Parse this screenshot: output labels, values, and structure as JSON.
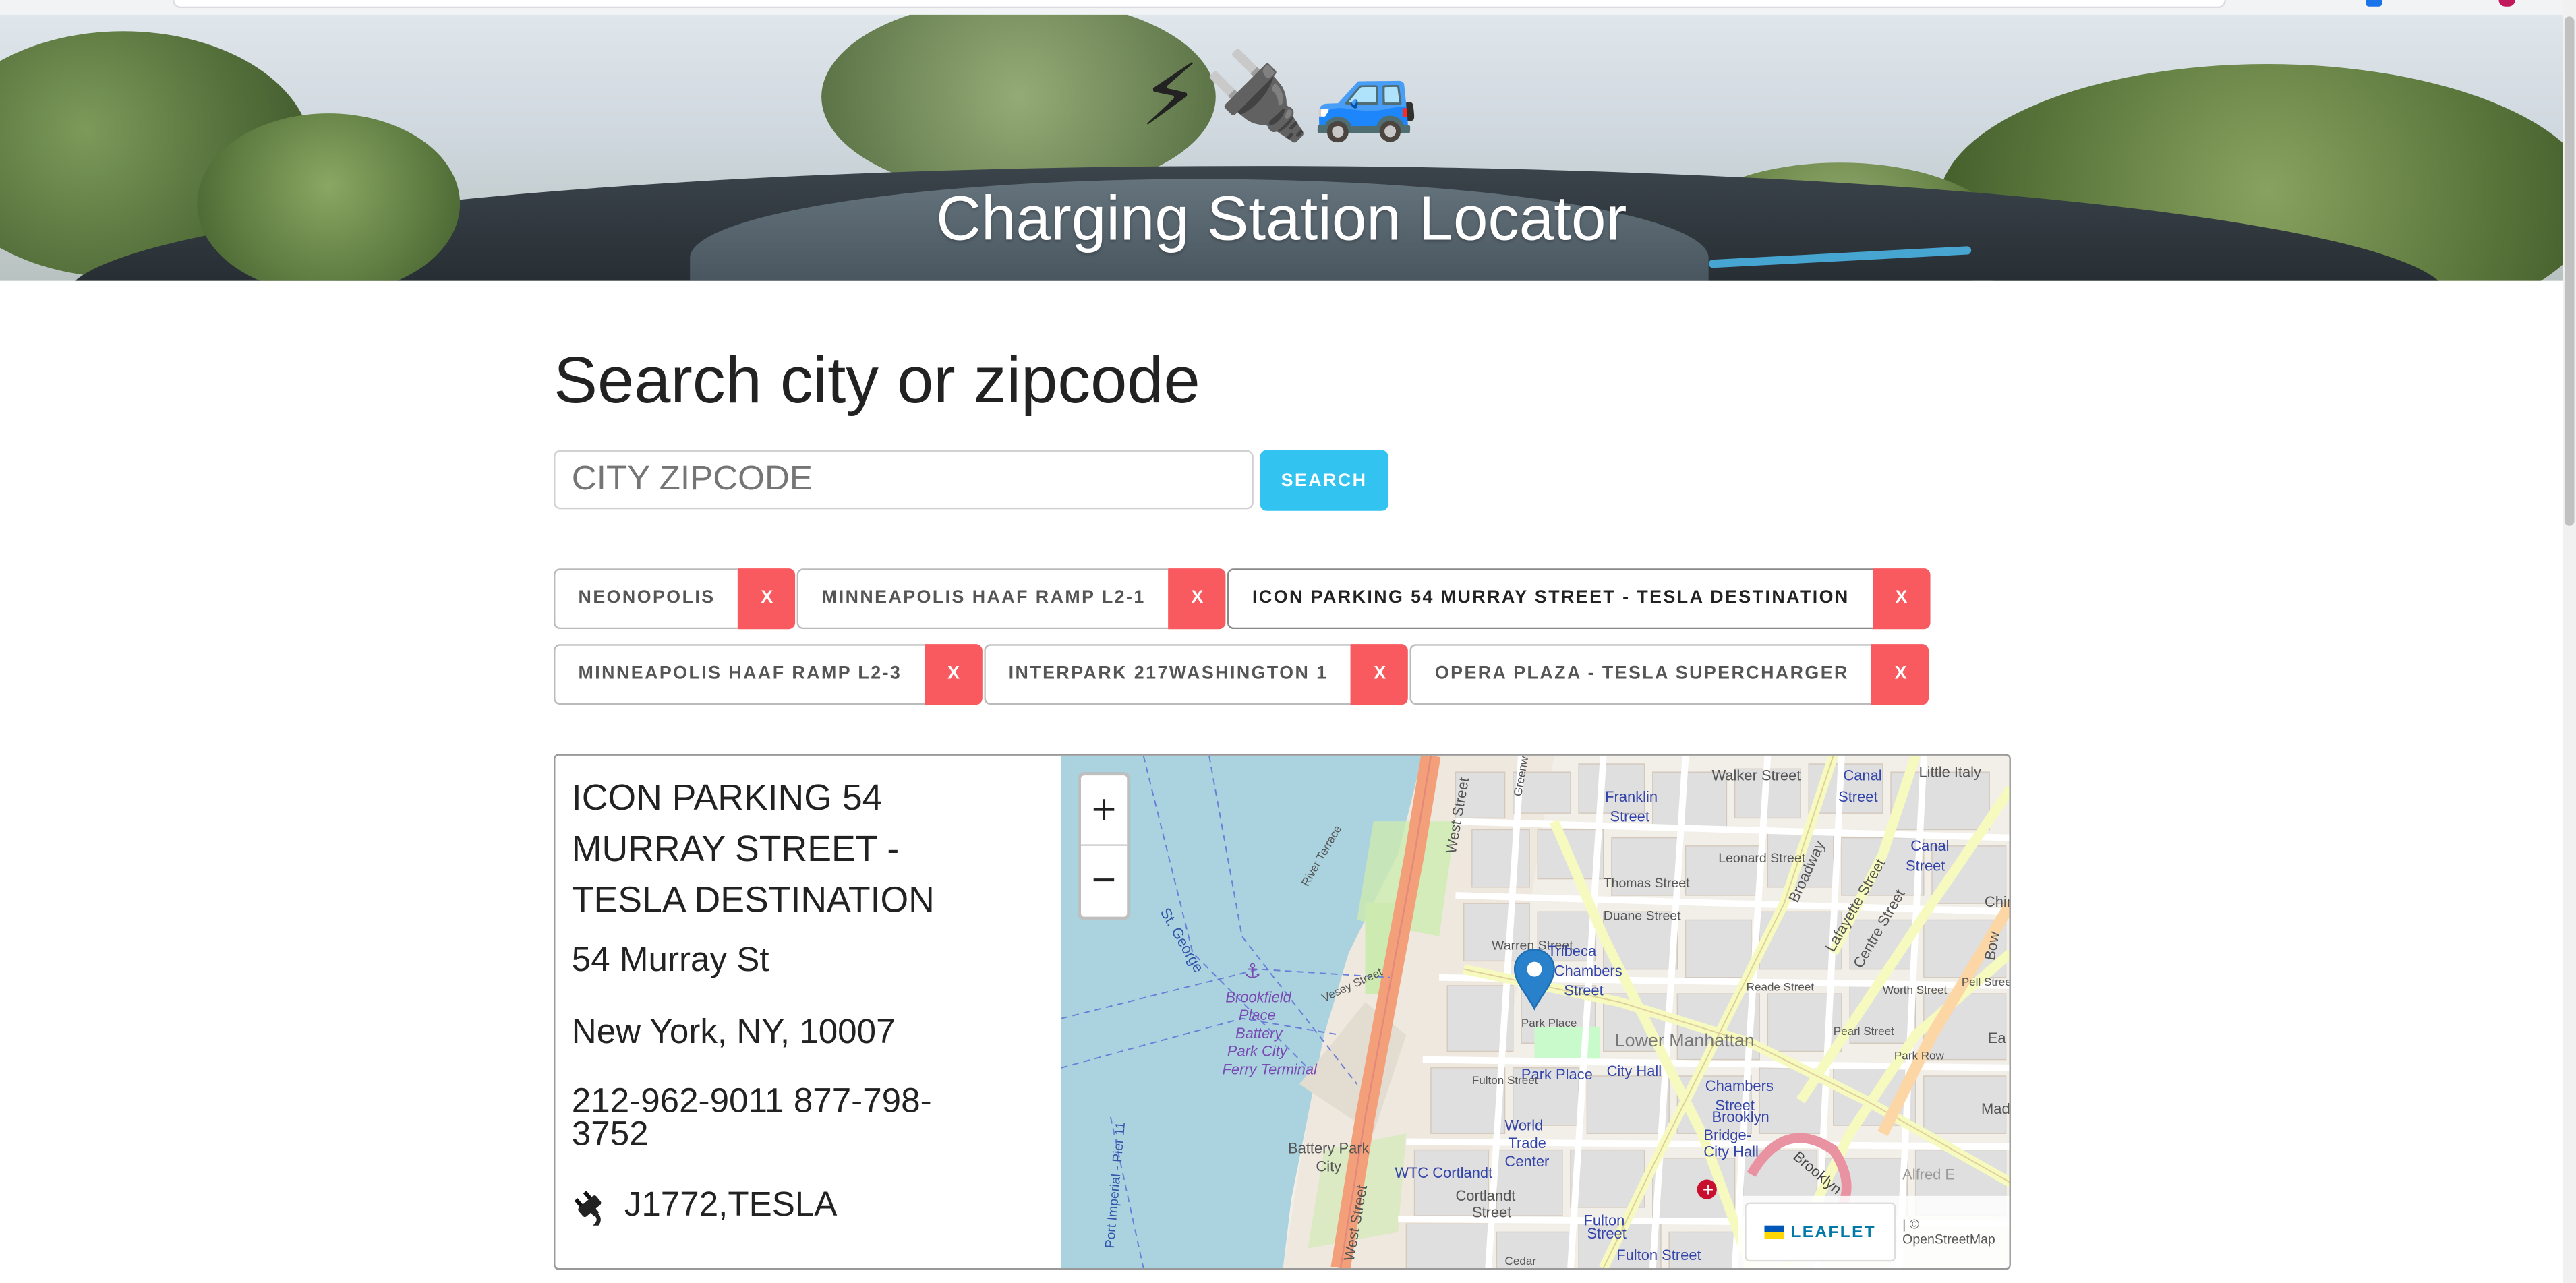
{
  "hero": {
    "emojis": "⚡🔌🚙",
    "title": "Charging Station Locator"
  },
  "search": {
    "heading": "Search city or zipcode",
    "placeholder": "CITY ZIPCODE",
    "value": "",
    "button_label": "SEARCH"
  },
  "saved_stations": [
    {
      "label": "NEONOPOLIS",
      "remove": "X"
    },
    {
      "label": "MINNEAPOLIS HAAF RAMP L2-1",
      "remove": "X"
    },
    {
      "label": "ICON PARKING 54 MURRAY STREET - TESLA DESTINATION",
      "remove": "X",
      "active": true
    },
    {
      "label": "MINNEAPOLIS HAAF RAMP L2-3",
      "remove": "X"
    },
    {
      "label": "INTERPARK 217WASHINGTON 1",
      "remove": "X"
    },
    {
      "label": "OPERA PLAZA - TESLA SUPERCHARGER",
      "remove": "X"
    }
  ],
  "station": {
    "name": "ICON PARKING 54 MURRAY STREET - TESLA DESTINATION",
    "street": "54 Murray St",
    "city_line": "New York, NY, 10007",
    "phone": "212-962-9011 877-798-3752",
    "connectors_icon": "plug-icon",
    "connectors": "J1772,TESLA"
  },
  "map": {
    "zoom_in": "+",
    "zoom_out": "−",
    "leaflet_label": "LEAFLET",
    "attribution": "| © OpenStreetMap",
    "labels": [
      "Walker Street",
      "Canal Street",
      "Little Italy",
      "Franklin Street",
      "Canal Street",
      "Leonard Street",
      "Broadway",
      "Lafayette Street",
      "Centre Street",
      "Thomas Street",
      "Duane Street",
      "Chin",
      "Warren Street",
      "Tribeca",
      "Chambers Street",
      "West Street",
      "Greenwich",
      "River Terrace",
      "St. George",
      "Vesey Street",
      "Brookfield Place",
      "Battery Park City Ferry Terminal",
      "Park Place",
      "Reade Street",
      "Worth Street",
      "Pearl Street",
      "Pell Street",
      "Bow",
      "Ea",
      "Madis",
      "Park Row",
      "Lower Manhattan",
      "Park Place",
      "City Hall",
      "Chambers Street",
      "Brooklyn Bridge-City Hall",
      "Fulton Street",
      "World Trade Center",
      "Cortlandt Street",
      "WTC Cortlandt",
      "Battery Park City",
      "Port Imperial - Pier 11",
      "West Street",
      "Fulton Street",
      "Fulton Street",
      "Brooklyn",
      "Alfred E",
      "Cedar"
    ]
  },
  "colors": {
    "search_button": "#33c3f0",
    "remove_button": "#f85a5f",
    "water": "#aad3df",
    "highway": "#f3a07a",
    "major_road": "#f7fabf",
    "marker": "#2a81cb"
  }
}
